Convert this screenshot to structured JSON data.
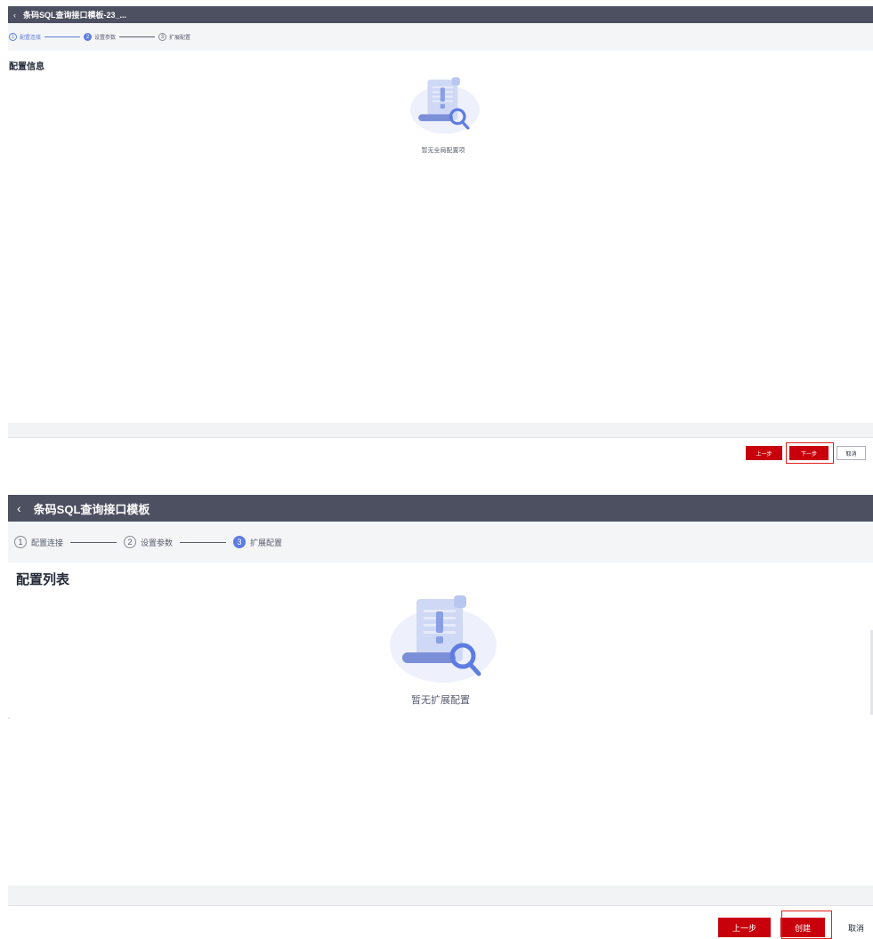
{
  "screen1": {
    "back_icon": "chevron-left-icon",
    "title": "条码SQL查询接口模板-23_...",
    "steps": [
      {
        "num": "1",
        "label": "配置连接",
        "state": "done"
      },
      {
        "num": "2",
        "label": "设置参数",
        "state": "active"
      },
      {
        "num": "3",
        "label": "扩展配置",
        "state": "pending"
      }
    ],
    "section_title": "配置信息",
    "empty_icon": "empty-document-search-icon",
    "empty_text": "暂无全局配置项",
    "buttons": {
      "prev": "上一步",
      "next": "下一步",
      "cancel": "取消"
    }
  },
  "screen2": {
    "back_icon": "chevron-left-icon",
    "title": "条码SQL查询接口模板",
    "steps": [
      {
        "num": "1",
        "label": "配置连接",
        "state": "pending"
      },
      {
        "num": "2",
        "label": "设置参数",
        "state": "pending"
      },
      {
        "num": "3",
        "label": "扩展配置",
        "state": "active"
      }
    ],
    "section_title": "配置列表",
    "empty_icon": "empty-document-search-icon",
    "empty_text": "暂无扩展配置",
    "buttons": {
      "prev": "上一步",
      "create": "创建",
      "cancel": "取消"
    }
  },
  "colors": {
    "primary": "#c7000b",
    "accent": "#5e7ce0",
    "titlebar": "#4c5060",
    "highlight": "#e0221e"
  }
}
